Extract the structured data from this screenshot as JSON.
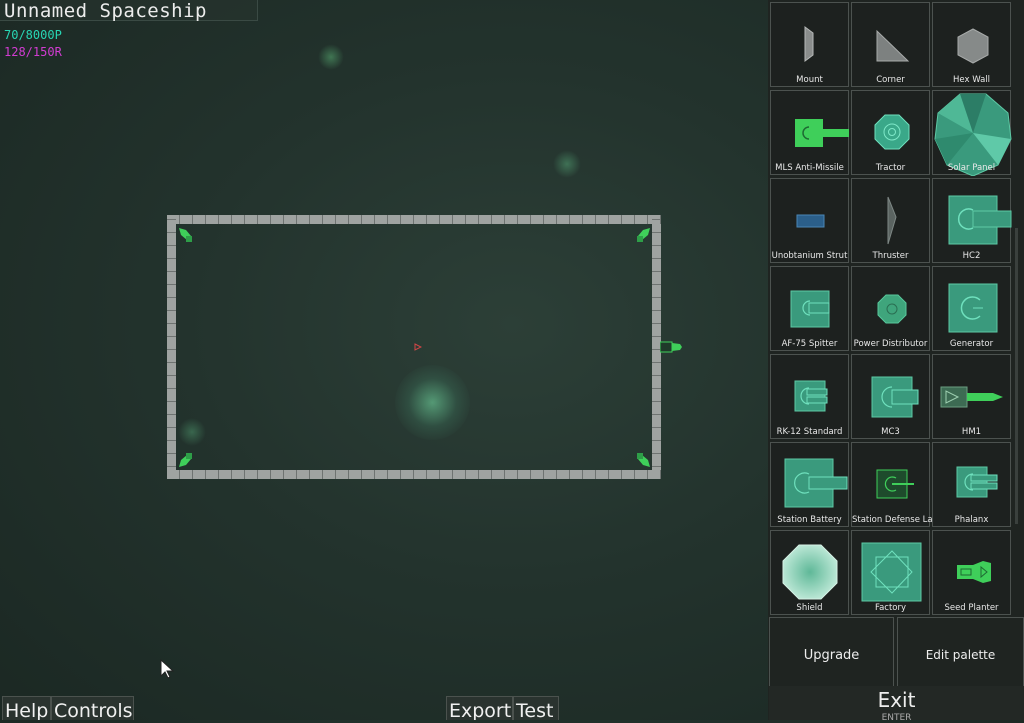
{
  "ship": {
    "name": "Unnamed Spaceship",
    "power": "70/8000P",
    "resources": "128/150R"
  },
  "palette": {
    "items": [
      {
        "label": "Mount",
        "icon": "mount-icon"
      },
      {
        "label": "Corner",
        "icon": "corner-icon"
      },
      {
        "label": "Hex Wall",
        "icon": "hex-wall-icon"
      },
      {
        "label": "MLS Anti-Missile",
        "icon": "anti-missile-icon"
      },
      {
        "label": "Tractor",
        "icon": "tractor-icon"
      },
      {
        "label": "Solar Panel",
        "icon": "solar-panel-icon"
      },
      {
        "label": "Unobtanium Strut",
        "icon": "strut-icon"
      },
      {
        "label": "Thruster",
        "icon": "thruster-icon"
      },
      {
        "label": "HC2",
        "icon": "cannon-icon"
      },
      {
        "label": "AF-75 Spitter",
        "icon": "spitter-icon"
      },
      {
        "label": "Power Distributor",
        "icon": "power-distributor-icon"
      },
      {
        "label": "Generator",
        "icon": "generator-icon"
      },
      {
        "label": "RK-12 Standard",
        "icon": "rocket-launcher-icon"
      },
      {
        "label": "MC3",
        "icon": "mass-cannon-icon"
      },
      {
        "label": "HM1",
        "icon": "homing-missile-icon"
      },
      {
        "label": "Station Battery",
        "icon": "station-battery-icon"
      },
      {
        "label": "Station Defense Laser",
        "icon": "defense-laser-icon"
      },
      {
        "label": "Phalanx",
        "icon": "phalanx-icon"
      },
      {
        "label": "Shield",
        "icon": "shield-icon"
      },
      {
        "label": "Factory",
        "icon": "factory-icon"
      },
      {
        "label": "Seed Planter",
        "icon": "seed-planter-icon"
      }
    ],
    "upgrade_label": "Upgrade",
    "edit_palette_label": "Edit palette",
    "exit_label": "Exit",
    "exit_key": "ENTER"
  },
  "bottom_bar": {
    "help_label": "Help",
    "controls_label": "Controls",
    "export_label": "Export",
    "test_label": "Test"
  },
  "colors": {
    "power_text": "#28d6b4",
    "resources_text": "#d23cd2",
    "module_green": "#3fcf5a",
    "module_teal": "#3aa889"
  }
}
